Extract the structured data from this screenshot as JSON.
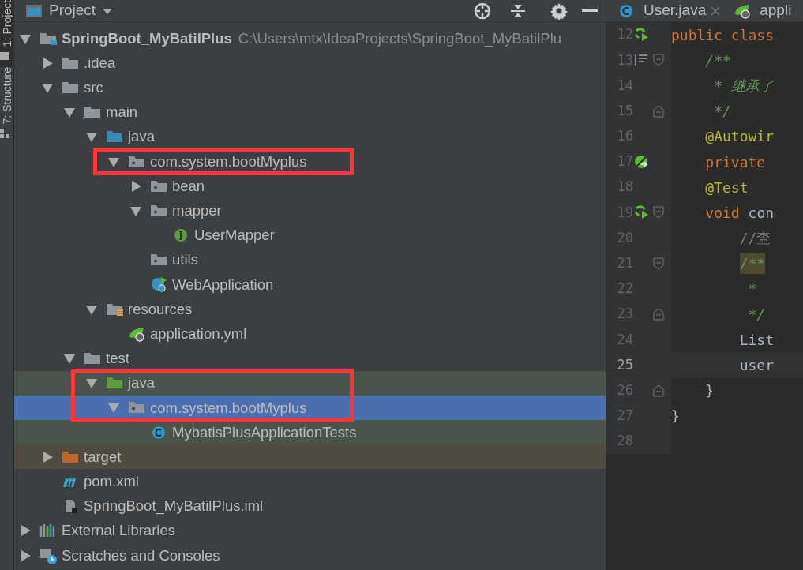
{
  "tool_strip": {
    "tabs": [
      {
        "label": "1: Project",
        "selected": true
      },
      {
        "label": "7: Structure",
        "selected": false
      }
    ]
  },
  "project_panel": {
    "title": "Project",
    "tree": [
      {
        "label": "SpringBoot_MyBatilPlus",
        "path": "C:\\Users\\mtx\\IdeaProjects\\SpringBoot_MyBatilPlu",
        "kind": "project",
        "expanded": true,
        "children": [
          {
            "label": ".idea",
            "kind": "folder",
            "expanded": false
          },
          {
            "label": "src",
            "kind": "folder",
            "expanded": true,
            "children": [
              {
                "label": "main",
                "kind": "folder",
                "expanded": true,
                "children": [
                  {
                    "label": "java",
                    "kind": "source-folder",
                    "expanded": true,
                    "children": [
                      {
                        "label": "com.system.bootMyplus",
                        "kind": "package",
                        "expanded": true,
                        "framed": true,
                        "children": [
                          {
                            "label": "bean",
                            "kind": "package",
                            "expanded": false
                          },
                          {
                            "label": "mapper",
                            "kind": "package",
                            "expanded": true,
                            "children": [
                              {
                                "label": "UserMapper",
                                "kind": "interface"
                              }
                            ]
                          },
                          {
                            "label": "utils",
                            "kind": "package"
                          },
                          {
                            "label": "WebApplication",
                            "kind": "spring-class"
                          }
                        ]
                      }
                    ]
                  },
                  {
                    "label": "resources",
                    "kind": "resources",
                    "expanded": true,
                    "children": [
                      {
                        "label": "application.yml",
                        "kind": "spring-yaml"
                      }
                    ]
                  }
                ]
              },
              {
                "label": "test",
                "kind": "folder",
                "expanded": true,
                "children": [
                  {
                    "label": "java",
                    "kind": "test-folder",
                    "expanded": true,
                    "test_scope": true,
                    "framed": true,
                    "children": [
                      {
                        "label": "com.system.bootMyplus",
                        "kind": "package",
                        "expanded": true,
                        "test_scope": true,
                        "selected": true,
                        "framed": true,
                        "children": [
                          {
                            "label": "MybatisPlusApplicationTests",
                            "kind": "class",
                            "test_scope": true
                          }
                        ]
                      }
                    ]
                  }
                ]
              }
            ]
          },
          {
            "label": "target",
            "kind": "excluded-folder",
            "expanded": false,
            "excluded": true
          },
          {
            "label": "pom.xml",
            "kind": "maven"
          },
          {
            "label": "SpringBoot_MyBatilPlus.iml",
            "kind": "iml"
          }
        ]
      },
      {
        "label": "External Libraries",
        "kind": "libraries",
        "expanded": false
      },
      {
        "label": "Scratches and Consoles",
        "kind": "scratches",
        "expanded": false
      }
    ]
  },
  "editor": {
    "tabs": [
      {
        "label": "User.java",
        "kind": "class",
        "closable": true
      },
      {
        "label": "appli",
        "kind": "spring-yaml"
      }
    ],
    "lines": [
      {
        "number": "12",
        "marker": {
          "kind": "run"
        },
        "tokens": [
          {
            "text": "public class",
            "kind": "keyword"
          }
        ]
      },
      {
        "number": "13",
        "marker": {
          "kind": "implemented"
        },
        "fold": {
          "kind": "start"
        },
        "tokens": [
          {
            "text": "    /**",
            "kind": "doc"
          }
        ]
      },
      {
        "number": "14",
        "tokens": [
          {
            "text": "     * 继承了",
            "kind": "doc"
          }
        ]
      },
      {
        "number": "15",
        "fold": {
          "kind": "end"
        },
        "tokens": [
          {
            "text": "     */",
            "kind": "doc"
          }
        ]
      },
      {
        "number": "16",
        "tokens": [
          {
            "text": "    @Autowir",
            "kind": "annotation"
          }
        ]
      },
      {
        "number": "17",
        "marker": {
          "kind": "bean"
        },
        "tokens": [
          {
            "text": "    private",
            "kind": "keyword"
          }
        ]
      },
      {
        "number": "18",
        "tokens": [
          {
            "text": "    @Test",
            "kind": "annotation"
          }
        ]
      },
      {
        "number": "19",
        "marker": {
          "kind": "run"
        },
        "fold": {
          "kind": "start"
        },
        "tokens": [
          {
            "text": "    void",
            "kind": "keyword"
          },
          {
            "text": " con",
            "kind": "plain"
          }
        ]
      },
      {
        "number": "20",
        "tokens": [
          {
            "text": "        //查",
            "kind": "comment"
          }
        ]
      },
      {
        "number": "21",
        "fold": {
          "kind": "start"
        },
        "tokens": [
          {
            "text": "        /**",
            "kind": "doc-highlight"
          }
        ]
      },
      {
        "number": "22",
        "tokens": [
          {
            "text": "         *",
            "kind": "doc"
          }
        ]
      },
      {
        "number": "23",
        "fold": {
          "kind": "end"
        },
        "tokens": [
          {
            "text": "         */",
            "kind": "doc"
          }
        ]
      },
      {
        "number": "24",
        "tokens": [
          {
            "text": "        List",
            "kind": "plain"
          }
        ]
      },
      {
        "number": "25",
        "current": true,
        "tokens": [
          {
            "text": "        user",
            "kind": "plain"
          }
        ]
      },
      {
        "number": "26",
        "fold": {
          "kind": "end"
        },
        "tokens": [
          {
            "text": "    }",
            "kind": "plain"
          }
        ]
      },
      {
        "number": "27",
        "tokens": [
          {
            "text": "}",
            "kind": "plain"
          }
        ]
      },
      {
        "number": "28"
      }
    ]
  }
}
